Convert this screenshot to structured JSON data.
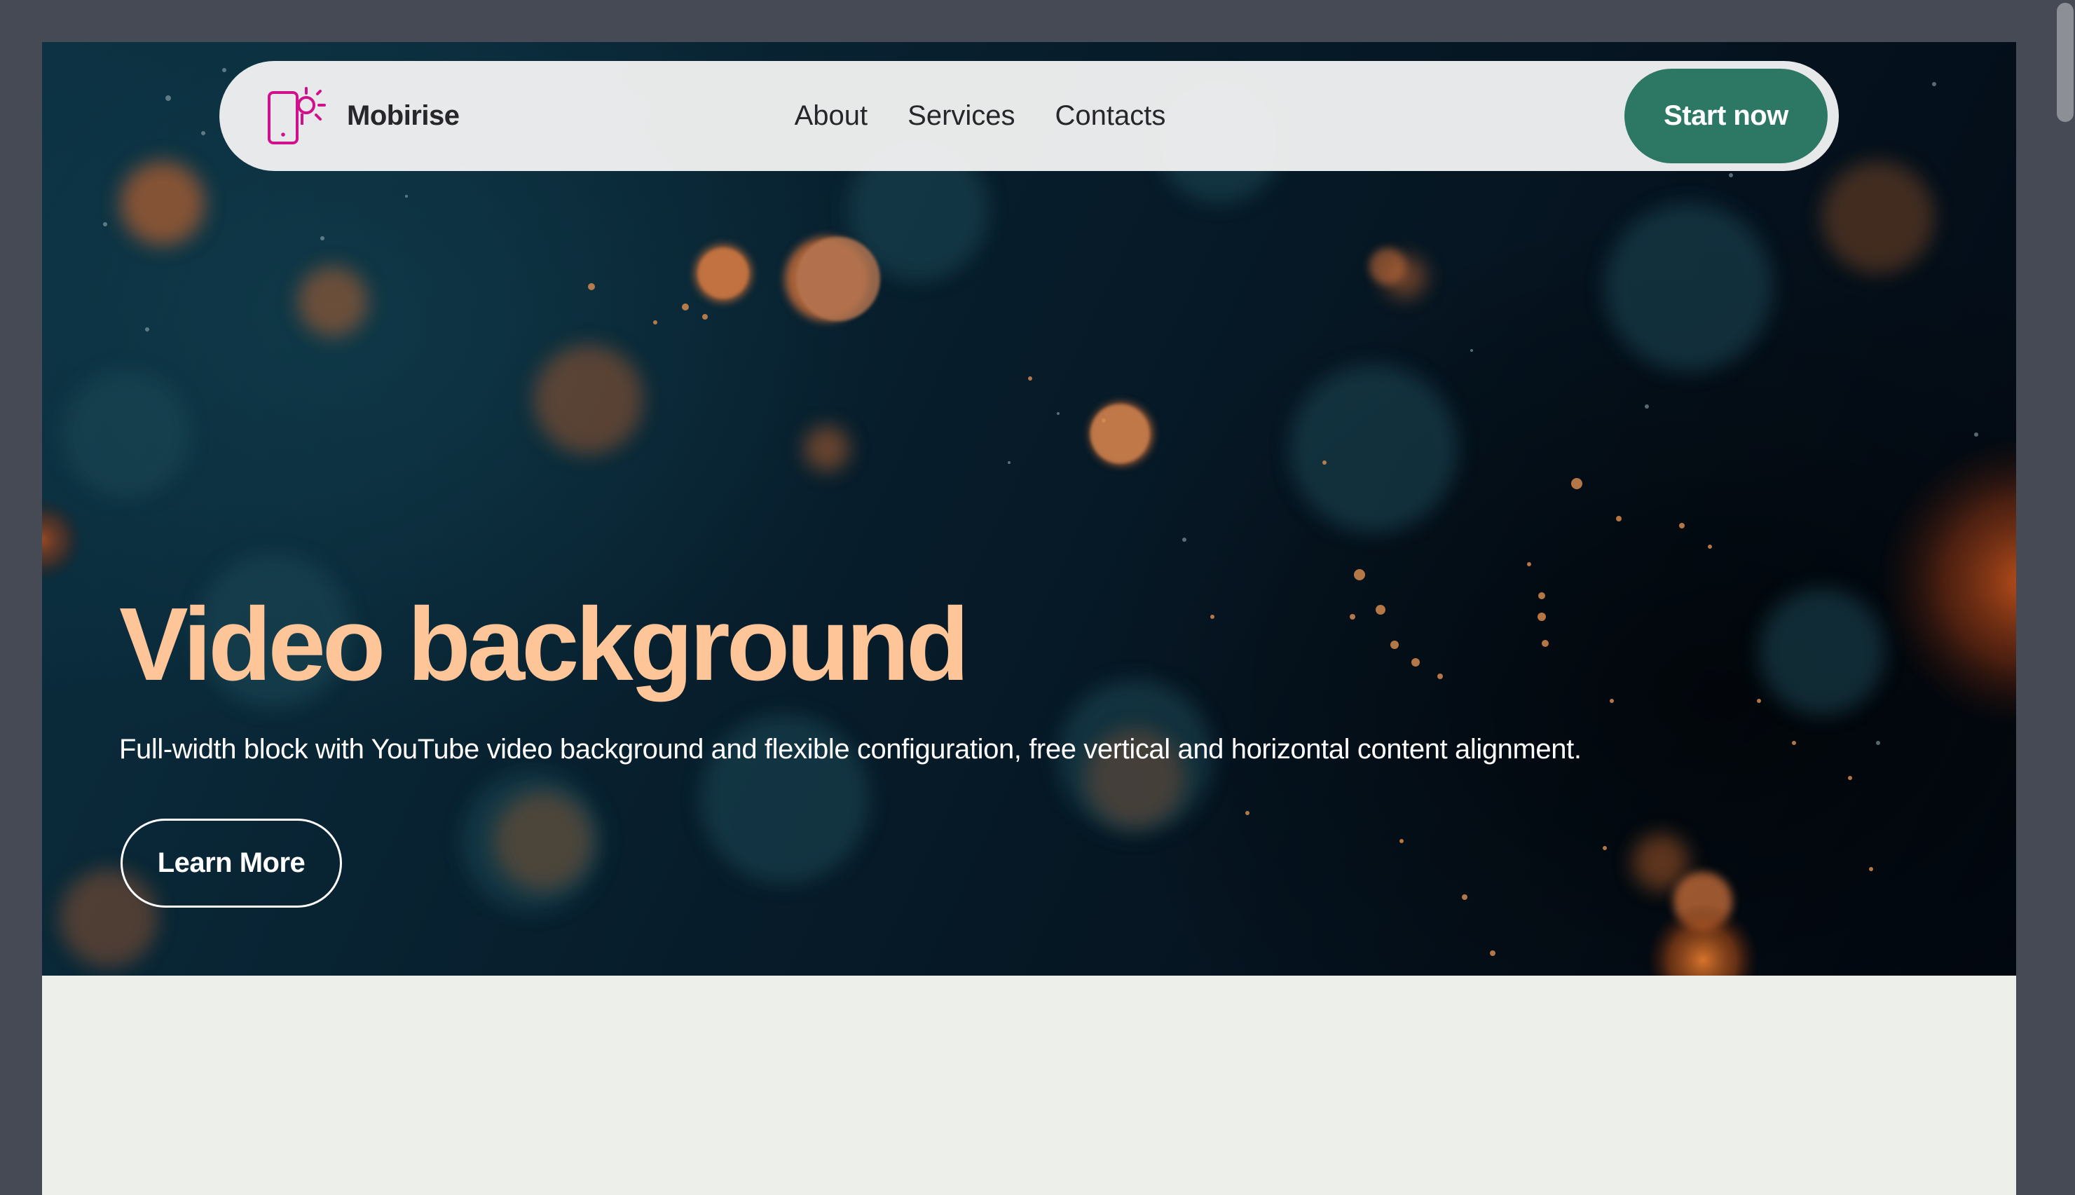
{
  "navbar": {
    "brand_name": "Mobirise",
    "links": [
      {
        "label": "About"
      },
      {
        "label": "Services"
      },
      {
        "label": "Contacts"
      }
    ],
    "cta_label": "Start now"
  },
  "hero": {
    "title": "Video background",
    "subtitle": "Full-width block with YouTube video background and flexible configuration, free vertical and horizontal content alignment.",
    "button_label": "Learn More"
  },
  "colors": {
    "page_background": "#464a55",
    "hero_title": "#fec599",
    "cta_background": "#2d7864",
    "brand_icon": "#d1118c",
    "section_background": "#edefeb",
    "navbar_background": "#eef0f0"
  },
  "icons": {
    "brand": "phone-bulb-icon"
  }
}
